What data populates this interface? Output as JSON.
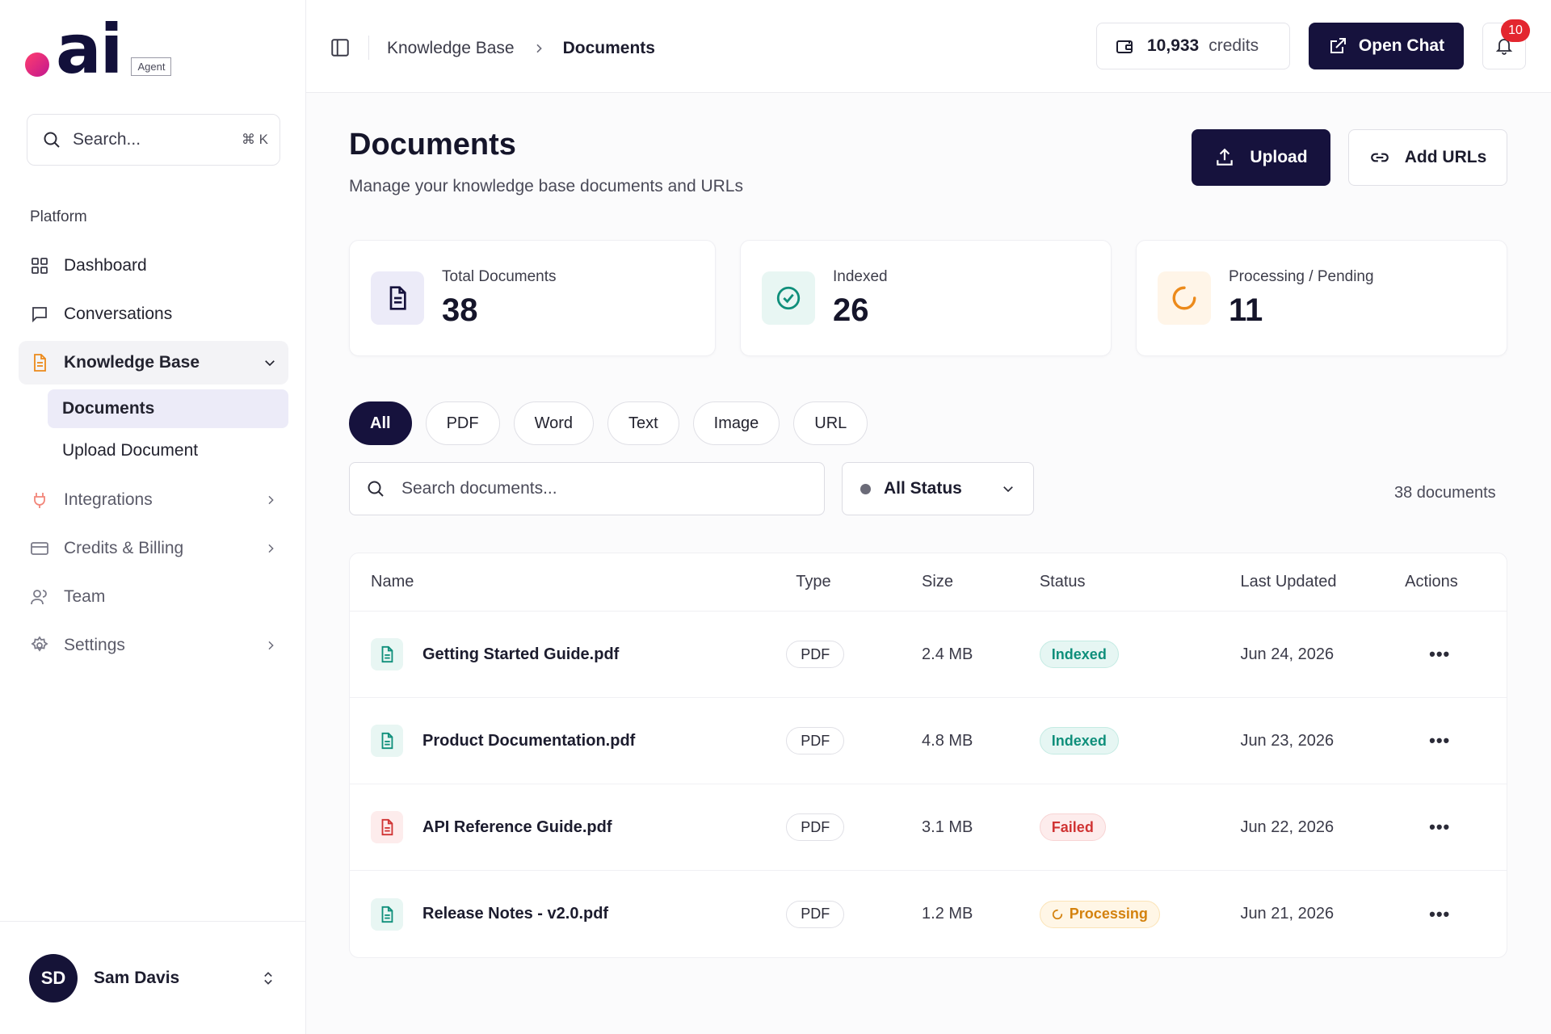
{
  "brand": {
    "wordmark": "ai",
    "badge": "Agent"
  },
  "sidebar": {
    "search_placeholder": "Search...",
    "search_shortcut": "⌘ K",
    "section_label": "Platform",
    "items": [
      {
        "label": "Dashboard",
        "icon": "grid-icon"
      },
      {
        "label": "Conversations",
        "icon": "chat-icon"
      },
      {
        "label": "Knowledge Base",
        "icon": "document-icon",
        "expanded": true
      },
      {
        "label": "Integrations",
        "icon": "plug-icon"
      },
      {
        "label": "Credits & Billing",
        "icon": "card-icon"
      },
      {
        "label": "Team",
        "icon": "users-icon"
      },
      {
        "label": "Settings",
        "icon": "gear-icon"
      }
    ],
    "subitems": [
      {
        "label": "Documents",
        "active": true
      },
      {
        "label": "Upload Document"
      }
    ],
    "user": {
      "initials": "SD",
      "name": "Sam Davis"
    }
  },
  "topbar": {
    "breadcrumb": [
      "Knowledge Base",
      "Documents"
    ],
    "credits_value": "10,933",
    "credits_unit": "credits",
    "open_chat_label": "Open Chat",
    "notification_count": "10"
  },
  "page": {
    "title": "Documents",
    "subtitle": "Manage your knowledge base documents and URLs",
    "upload_label": "Upload",
    "add_urls_label": "Add URLs"
  },
  "stats": [
    {
      "label": "Total Documents",
      "value": "38",
      "icon": "document-icon",
      "color": "#16123d"
    },
    {
      "label": "Indexed",
      "value": "26",
      "icon": "check-circle-icon",
      "color": "#0f8f7b"
    },
    {
      "label": "Processing / Pending",
      "value": "11",
      "icon": "spinner-icon",
      "color": "#ec8a1b"
    }
  ],
  "filters": {
    "chips": [
      "All",
      "PDF",
      "Word",
      "Text",
      "Image",
      "URL"
    ],
    "active": "All",
    "search_placeholder": "Search documents...",
    "status_value": "All Status",
    "count_label": "38 documents"
  },
  "table": {
    "headers": [
      "Name",
      "Type",
      "Size",
      "Status",
      "Last Updated",
      "Actions"
    ],
    "rows": [
      {
        "name": "Getting Started Guide.pdf",
        "type": "PDF",
        "size": "2.4 MB",
        "status": "Indexed",
        "status_kind": "indexed",
        "updated": "Jun 24, 2026"
      },
      {
        "name": "Product Documentation.pdf",
        "type": "PDF",
        "size": "4.8 MB",
        "status": "Indexed",
        "status_kind": "indexed",
        "updated": "Jun 23, 2026"
      },
      {
        "name": "API Reference Guide.pdf",
        "type": "PDF",
        "size": "3.1 MB",
        "status": "Failed",
        "status_kind": "failed",
        "updated": "Jun 22, 2026"
      },
      {
        "name": "Release Notes - v2.0.pdf",
        "type": "PDF",
        "size": "1.2 MB",
        "status": "Processing",
        "status_kind": "processing",
        "updated": "Jun 21, 2026"
      }
    ],
    "actions_glyph": "•••"
  }
}
